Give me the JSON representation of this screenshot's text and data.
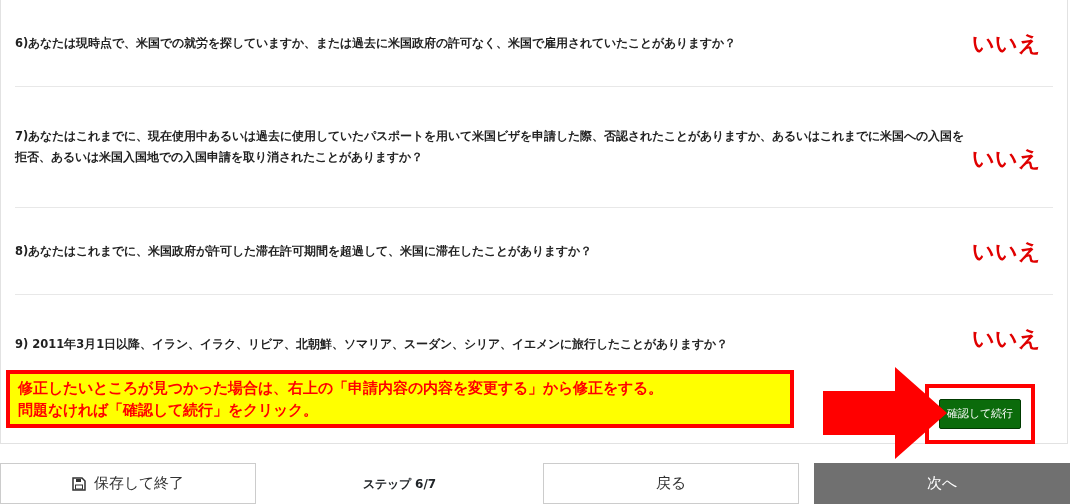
{
  "questions": [
    {
      "text": "6)あなたは現時点で、米国での就労を探していますか、または過去に米国政府の許可なく、米国で雇用されていたことがありますか？",
      "answer": "いいえ"
    },
    {
      "text": "7)あなたはこれまでに、現在使用中あるいは過去に使用していたパスポートを用いて米国ビザを申請した際、否認されたことがありますか、あるいはこれまでに米国への入国を拒否、あるいは米国入国地での入国申請を取り消されたことがありますか？",
      "answer": "いいえ"
    },
    {
      "text": "8)あなたはこれまでに、米国政府が許可した滞在許可期間を超過して、米国に滞在したことがありますか？",
      "answer": "いいえ"
    },
    {
      "text": "9) 2011年3月1日以降、イラン、イラク、リビア、北朝鮮、ソマリア、スーダン、シリア、イエメンに旅行したことがありますか？",
      "answer": "いいえ"
    }
  ],
  "note": [
    "修正したいところが見つかった場合は、右上の「申請内容の内容を変更する」から修正をする。",
    "問題なければ「確認して続行」をクリック。"
  ],
  "confirm_button": "確認して続行",
  "footer": {
    "save": "保存して終了",
    "step": "ステップ 6/7",
    "back": "戻る",
    "next": "次へ"
  }
}
